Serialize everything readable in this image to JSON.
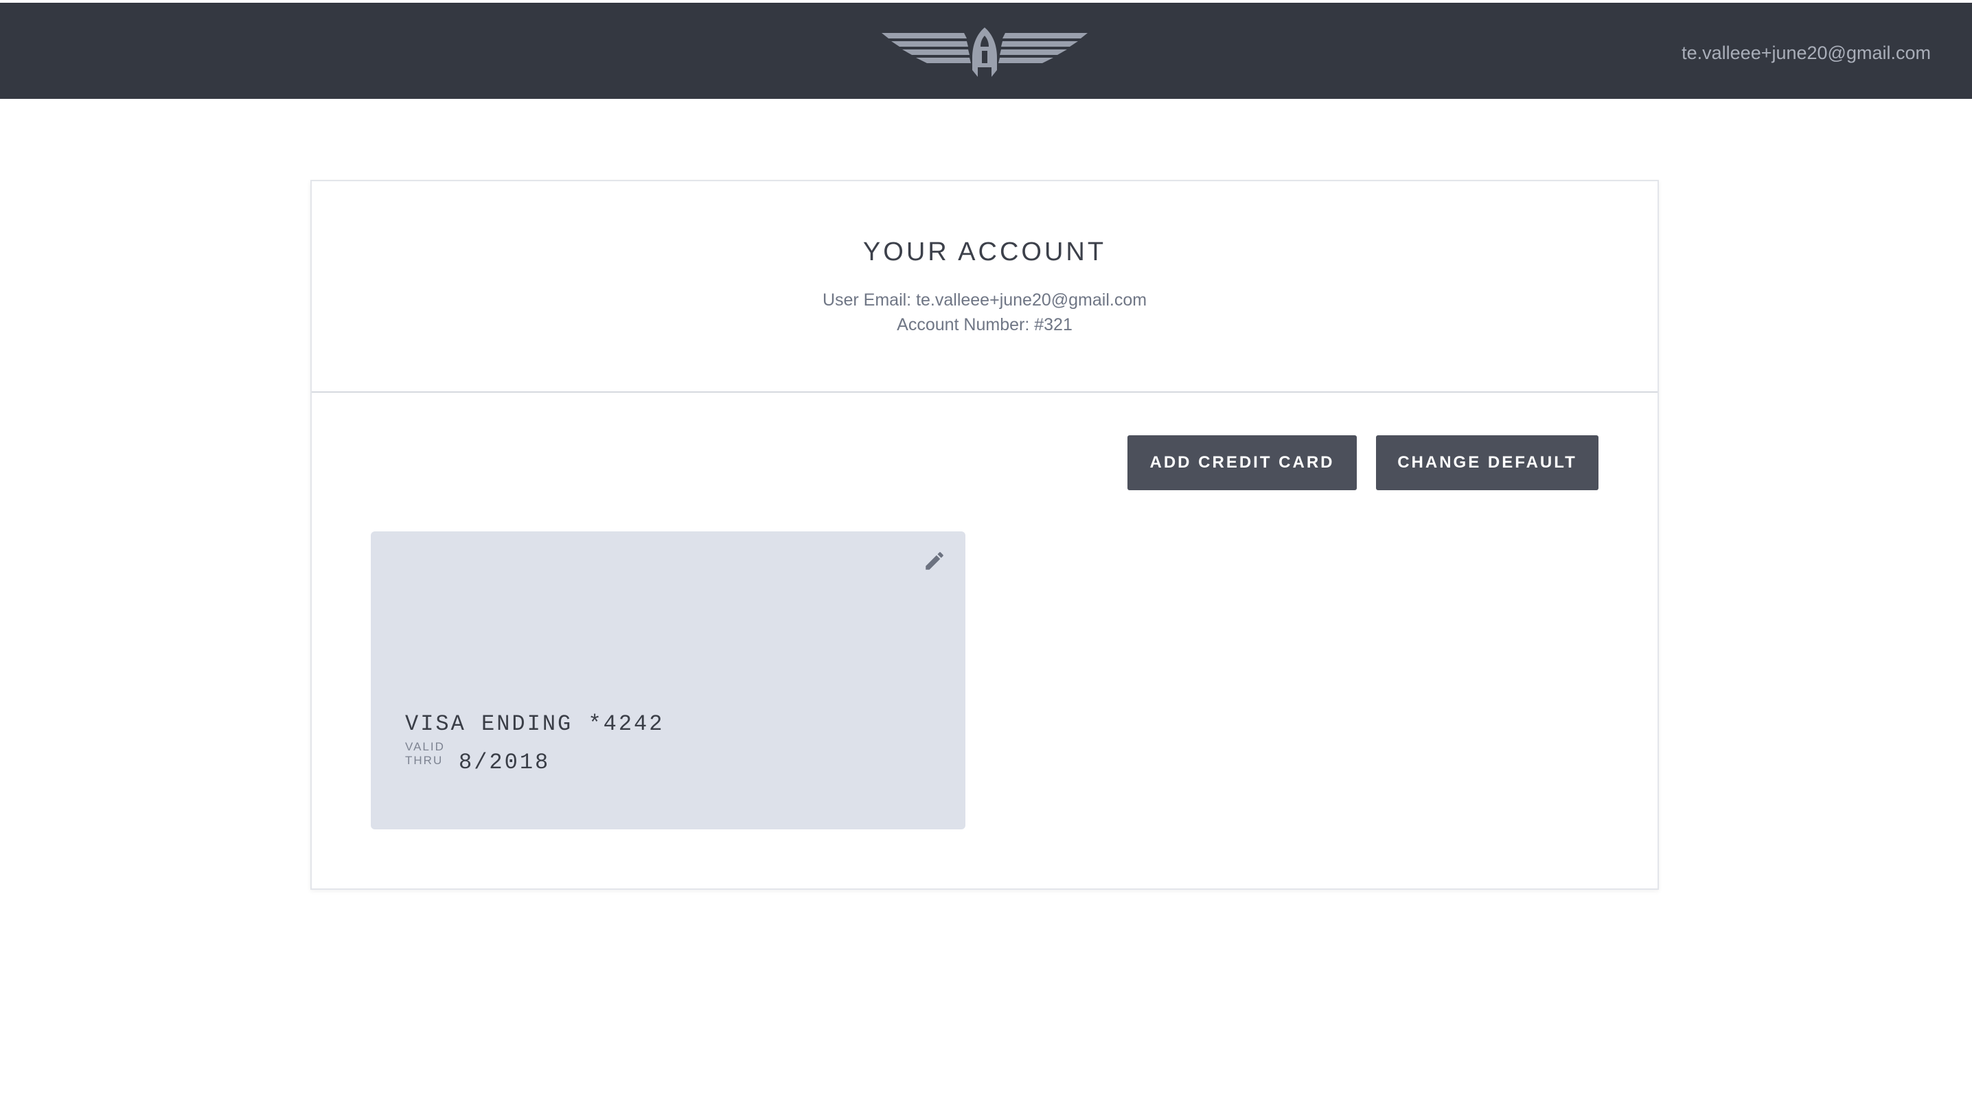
{
  "header": {
    "logo_icon": "winged-rocket-logo",
    "user_email": "te.valleee+june20@gmail.com",
    "background_color": "#343841"
  },
  "account": {
    "title": "YOUR ACCOUNT",
    "email_line": "User Email: te.valleee+june20@gmail.com",
    "account_number_line": "Account Number: #321"
  },
  "actions": {
    "add_credit_card_label": "ADD CREDIT CARD",
    "change_default_label": "CHANGE DEFAULT",
    "button_color": "#4c505b"
  },
  "cards": [
    {
      "label": "VISA ENDING *4242",
      "valid_label_1": "VALID",
      "valid_label_2": "THRU",
      "expiry": "8/2018",
      "edit_icon": "pencil-icon",
      "background_color": "#dde1ea"
    }
  ]
}
